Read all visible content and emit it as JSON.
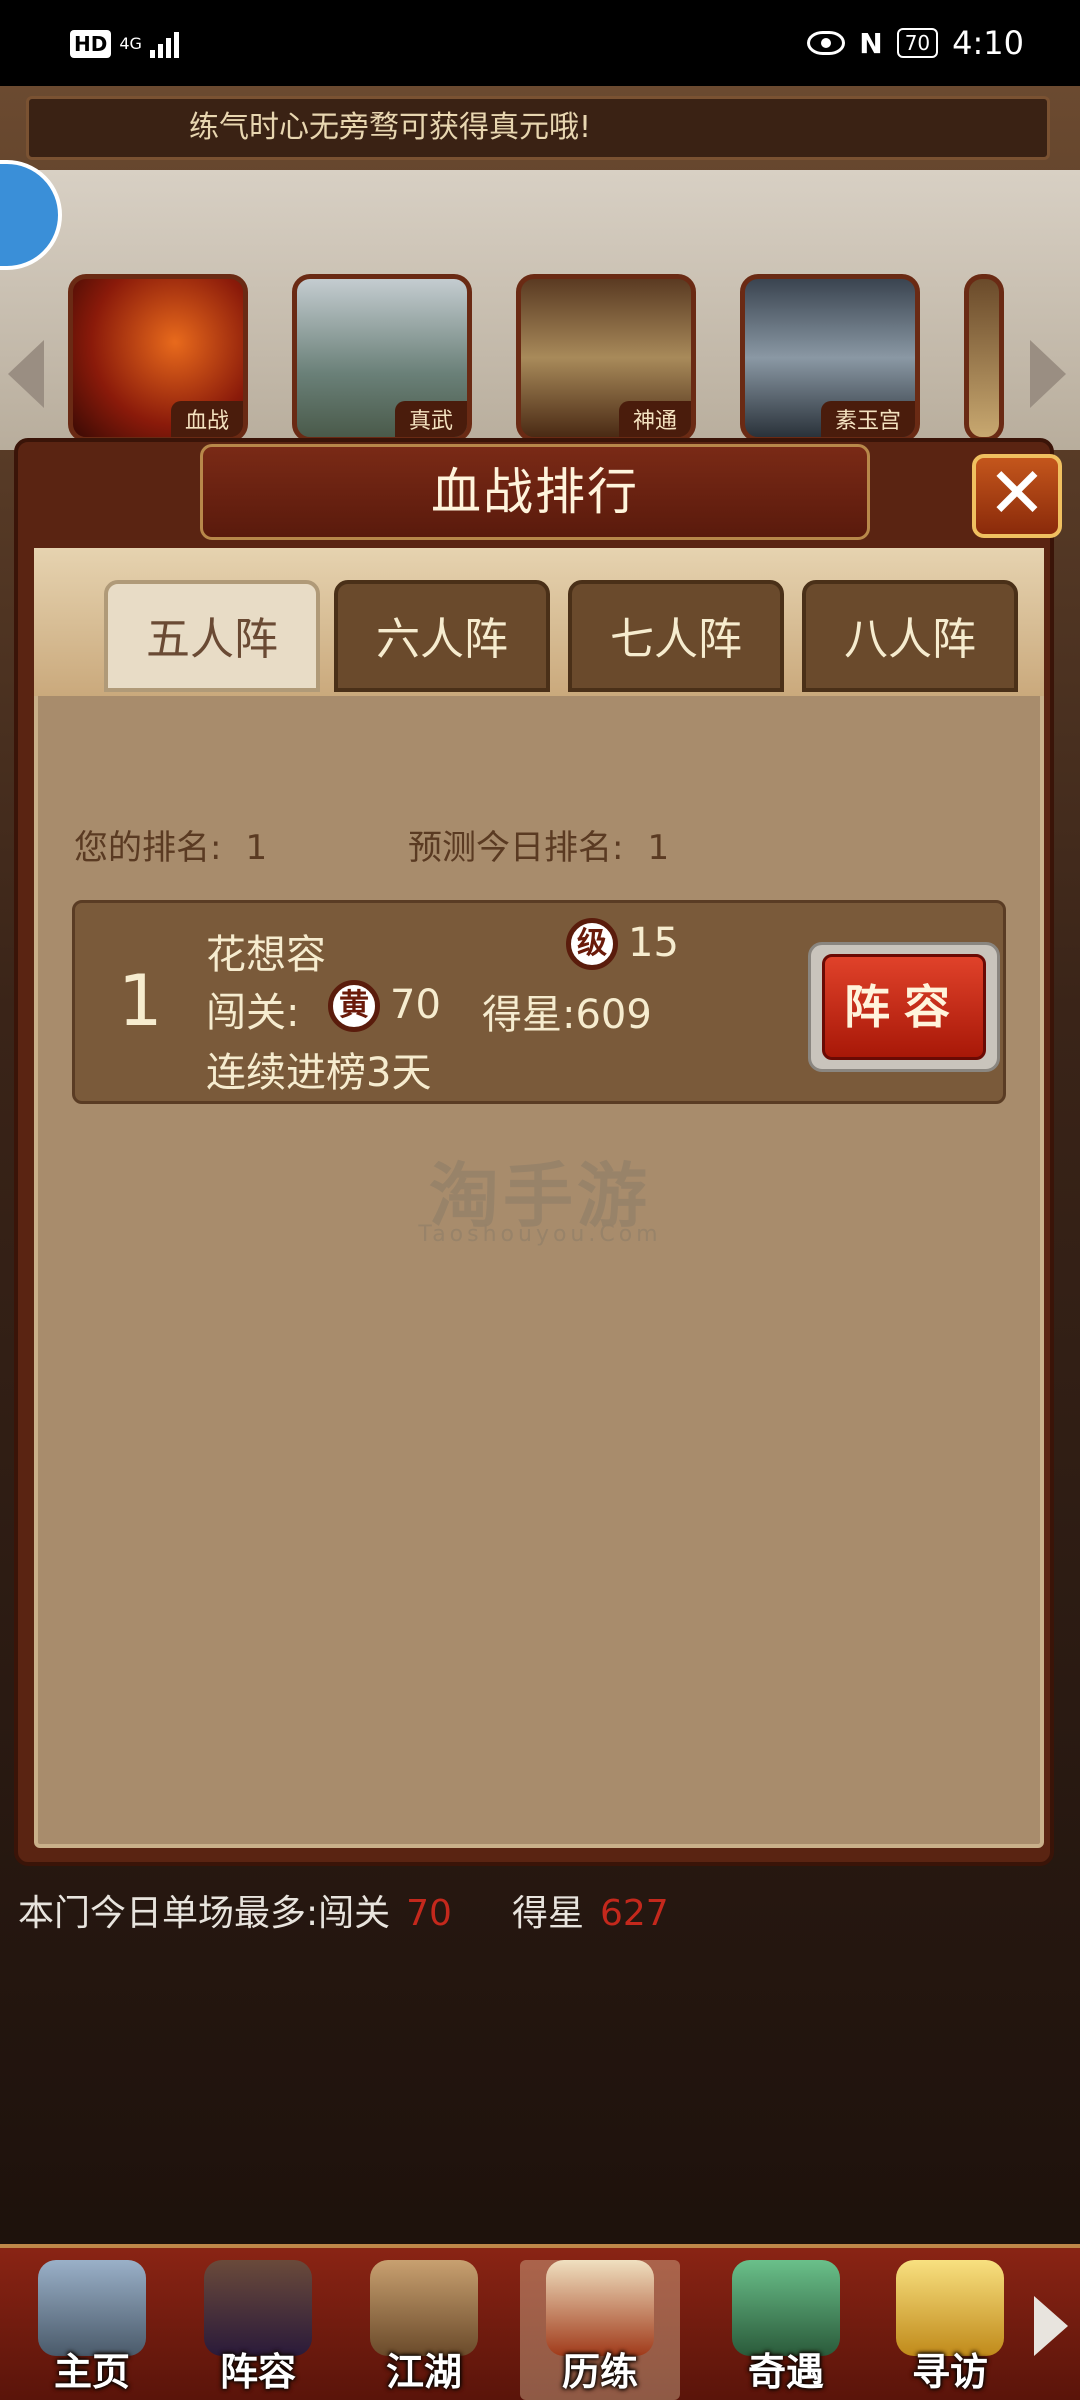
{
  "status_bar": {
    "hd": "HD",
    "network": "4G",
    "battery": "70",
    "time": "4:10"
  },
  "tip": "练气时心无旁骛可获得真元哦!",
  "modes": [
    {
      "label": "血战"
    },
    {
      "label": "真武"
    },
    {
      "label": "神通"
    },
    {
      "label": "素玉宫"
    }
  ],
  "dialog": {
    "title": "血战排行",
    "close": "✕",
    "tabs": [
      {
        "label": "五人阵"
      },
      {
        "label": "六人阵"
      },
      {
        "label": "七人阵"
      },
      {
        "label": "八人阵"
      }
    ],
    "my_rank_label": "您的排名:",
    "my_rank_value": "1",
    "predicted_rank_label": "预测今日排名:",
    "predicted_rank_value": "1",
    "entries": [
      {
        "rank": "1",
        "name": "花想容",
        "level_badge": "级",
        "level": "15",
        "stage_label": "闯关:",
        "tier_badge": "黄",
        "stage": "70",
        "stars_label": "得星:",
        "stars": "609",
        "streak": "连续进榜3天",
        "lineup_button": "阵容"
      }
    ]
  },
  "watermark": {
    "main": "淘手游",
    "sub": "Taoshouyou.Com"
  },
  "sect_best": {
    "label": "本门今日单场最多:",
    "stage_label": "闯关",
    "stage_value": "70",
    "stars_label": "得星",
    "stars_value": "627"
  },
  "bottom_nav": [
    {
      "label": "主页"
    },
    {
      "label": "阵容"
    },
    {
      "label": "江湖"
    },
    {
      "label": "历练"
    },
    {
      "label": "奇遇"
    },
    {
      "label": "寻访"
    }
  ]
}
